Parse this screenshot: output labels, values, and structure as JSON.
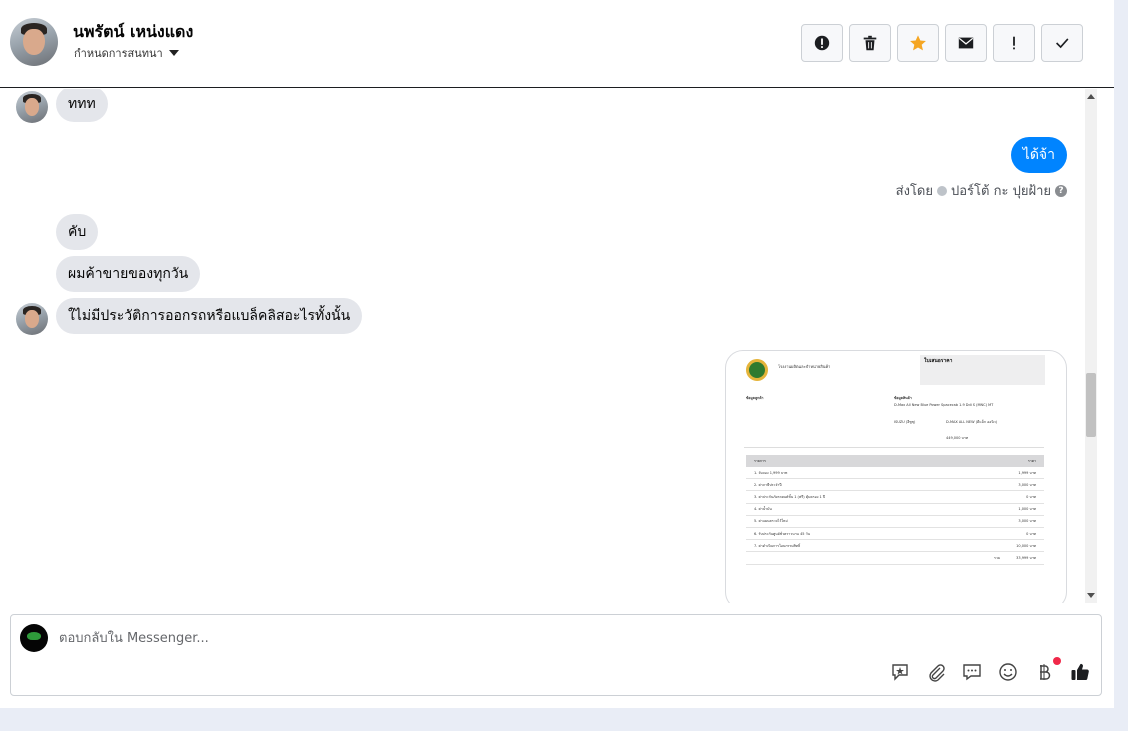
{
  "header": {
    "contact_name": "นพรัตน์ เหน่งแดง",
    "assign_label": "กำหนดการสนทนา",
    "actions": [
      {
        "icon": "spam-alert-icon"
      },
      {
        "icon": "trash-icon"
      },
      {
        "icon": "star-icon",
        "color": "#f5a623"
      },
      {
        "icon": "envelope-icon"
      },
      {
        "icon": "exclamation-icon"
      },
      {
        "icon": "check-icon"
      }
    ]
  },
  "thread": {
    "messages": {
      "m1": "ททท",
      "m2": "ได้จ้า",
      "m3": "คับ",
      "m4": "ผมค้าขายของทุกวัน",
      "m5": "ใไม่มีประวัติการออกรถหรือแบล็คลิสอะไรทั้งนั้น"
    },
    "sent_by": "ส่งโดย",
    "sender_name": "ปอร์โต้ กะ ปุยฝ้าย",
    "outgoing_color": "#0084ff"
  },
  "document": {
    "title": "ใบเสนอราคา",
    "company": "โรงงานผลิตและจำหน่ายสินค้า",
    "customer_label": "ข้อมูลลูกค้า",
    "product_label": "ข้อมูลสินค้า",
    "product": "D-Max All New Blue Power Spacecab 1.9 Ddi S (MNC) MT",
    "brand": "ISUZU (อีซูซุ)",
    "model": "D-MAX ALL NEW (ดีแม็ก ออนิว)",
    "price": "449,000 บาท",
    "table_header": [
      "รายการ",
      "ราคา"
    ],
    "rows": [
      [
        "1. จับจอง 1,999 บาท",
        "1,999 บาท"
      ],
      [
        "2. ค่าภาษีประจำปี",
        "3,000 บาท"
      ],
      [
        "3. ค่าประกันภัยรถยนต์ชั้น 1 (ฟรี) คุ้มครอง 1 ปี",
        "0 บาท"
      ],
      [
        "4. ค่าน้ำมัน",
        "1,000 บาท"
      ],
      [
        "5. ค่าแผนตรวจไว้ใหม่",
        "3,000 บาท"
      ],
      [
        "6. รับประกันศูนย์ชั่วคราวนาน 45 วัน",
        "0 บาท"
      ],
      [
        "7. ค่าดำเนินการโอนกรรมสิทธิ์",
        "10,000 บาท"
      ]
    ],
    "total_label": "รวม",
    "total": "33,999 บาท"
  },
  "composer": {
    "placeholder": "ตอบกลับใน Messenger...",
    "tools": [
      "saved-reply-icon",
      "attachment-icon",
      "quick-reply-icon",
      "emoji-icon",
      "payment-icon",
      "like-icon"
    ]
  }
}
